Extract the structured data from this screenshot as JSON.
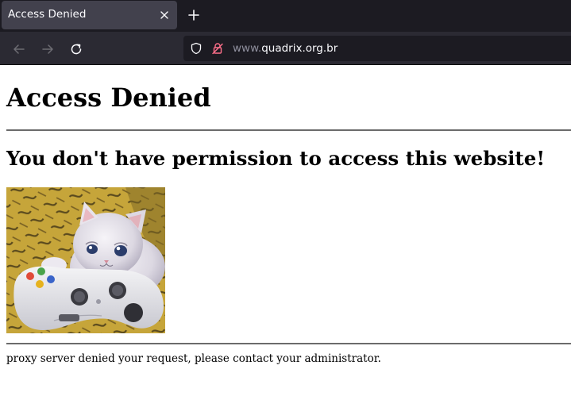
{
  "browser": {
    "tab": {
      "title": "Access Denied",
      "close_icon": "close-icon"
    },
    "new_tab_icon": "plus-icon",
    "nav": {
      "back_icon": "arrow-left-icon",
      "forward_icon": "arrow-right-icon",
      "reload_icon": "reload-icon"
    },
    "urlbar": {
      "prefix": "www.",
      "host": "quadrix.org.br",
      "tracking_icon": "shield-icon",
      "security_icon": "insecure-lock-icon"
    },
    "colors": {
      "tabstrip_bg": "#1c1b22",
      "active_tab_bg": "#42414d",
      "navbar_bg": "#2b2a33",
      "urlbar_bg": "#1c1b22",
      "insecure_lock": "#ff6f8a"
    }
  },
  "page": {
    "title": "Access Denied",
    "subtitle": "You don't have permission to access this website!",
    "image": "crying-kitten-holding-game-controller",
    "footer": "proxy server denied your request, please contact your administrator."
  }
}
